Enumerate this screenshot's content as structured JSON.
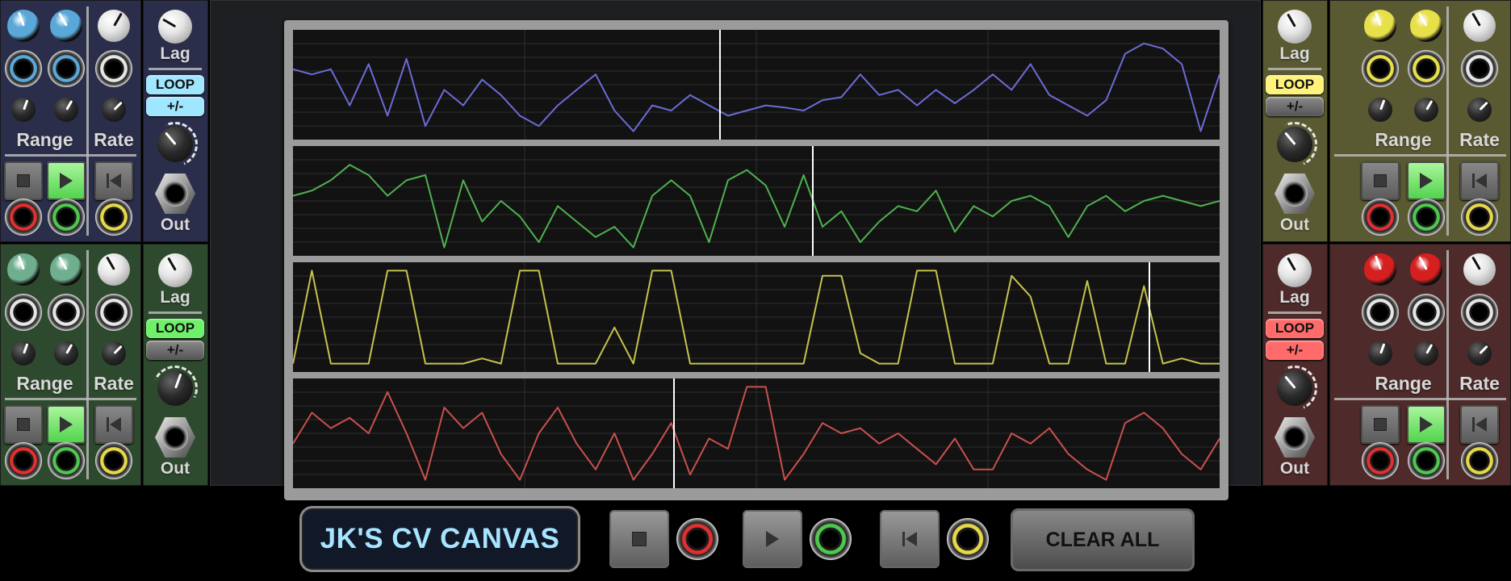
{
  "title": "JK'S CV CANVAS",
  "clear_label": "CLEAR ALL",
  "labels": {
    "lag": "Lag",
    "out": "Out",
    "range": "Range",
    "rate": "Rate",
    "loop": "LOOP",
    "plusminus": "+/-"
  },
  "modules": [
    {
      "id": "blue",
      "accent": "#5aa8d8",
      "bg": "#2b2e4a",
      "side_bg": "#2b2e4a",
      "loop_color": "#9fe6ff",
      "pm_color": "#9fe6ff",
      "loop_on": true,
      "pm_on": true
    },
    {
      "id": "green",
      "accent": "#6fae8e",
      "bg": "#2e4a2e",
      "side_bg": "#2e4a2e",
      "loop_color": "#6ef06a",
      "pm_color": "#8a8a8a",
      "loop_on": true,
      "pm_on": false
    },
    {
      "id": "yellow",
      "accent": "#e8e04a",
      "bg": "#5a5a32",
      "side_bg": "#5a5a32",
      "loop_color": "#fff27a",
      "pm_color": "#8a8a8a",
      "loop_on": true,
      "pm_on": false
    },
    {
      "id": "red",
      "accent": "#d62020",
      "bg": "#4e2a2a",
      "side_bg": "#4e2a2a",
      "loop_color": "#ff6a6a",
      "pm_color": "#ff6a6a",
      "loop_on": true,
      "pm_on": true
    }
  ],
  "colors": {
    "frame": "#9b9b9b",
    "track_bg": "#121212",
    "jack_red": "#e03030",
    "jack_green": "#4ec84e",
    "jack_yellow": "#e6d84a",
    "title_text": "#a6e4ff"
  },
  "tracks": [
    {
      "color": "#6b6bd6",
      "cursor": 0.46,
      "points": [
        0.35,
        0.4,
        0.35,
        0.7,
        0.3,
        0.8,
        0.25,
        0.9,
        0.55,
        0.7,
        0.45,
        0.6,
        0.8,
        0.9,
        0.7,
        0.55,
        0.4,
        0.75,
        0.95,
        0.7,
        0.75,
        0.6,
        0.7,
        0.8,
        0.75,
        0.7,
        0.72,
        0.75,
        0.65,
        0.62,
        0.4,
        0.6,
        0.55,
        0.7,
        0.55,
        0.68,
        0.55,
        0.4,
        0.55,
        0.3,
        0.6,
        0.7,
        0.8,
        0.65,
        0.2,
        0.1,
        0.15,
        0.3,
        0.95,
        0.4
      ]
    },
    {
      "color": "#4fb04f",
      "cursor": 0.56,
      "points": [
        0.45,
        0.4,
        0.3,
        0.15,
        0.25,
        0.45,
        0.3,
        0.25,
        0.95,
        0.3,
        0.7,
        0.5,
        0.65,
        0.9,
        0.55,
        0.7,
        0.85,
        0.75,
        0.95,
        0.45,
        0.3,
        0.45,
        0.9,
        0.3,
        0.2,
        0.35,
        0.75,
        0.25,
        0.75,
        0.6,
        0.9,
        0.7,
        0.55,
        0.6,
        0.4,
        0.8,
        0.55,
        0.65,
        0.5,
        0.45,
        0.55,
        0.85,
        0.55,
        0.45,
        0.6,
        0.5,
        0.45,
        0.5,
        0.55,
        0.5
      ]
    },
    {
      "color": "#c6c24e",
      "cursor": 0.923,
      "points": [
        0.95,
        0.05,
        0.95,
        0.95,
        0.95,
        0.05,
        0.05,
        0.95,
        0.95,
        0.95,
        0.9,
        0.95,
        0.05,
        0.05,
        0.95,
        0.95,
        0.95,
        0.6,
        0.95,
        0.05,
        0.05,
        0.95,
        0.95,
        0.95,
        0.95,
        0.95,
        0.95,
        0.95,
        0.1,
        0.1,
        0.85,
        0.95,
        0.95,
        0.05,
        0.05,
        0.95,
        0.95,
        0.95,
        0.1,
        0.3,
        0.95,
        0.95,
        0.15,
        0.95,
        0.95,
        0.2,
        0.95,
        0.9,
        0.95,
        0.95
      ]
    },
    {
      "color": "#c8504e",
      "cursor": 0.41,
      "points": [
        0.6,
        0.3,
        0.45,
        0.35,
        0.5,
        0.1,
        0.5,
        0.95,
        0.25,
        0.45,
        0.3,
        0.7,
        0.95,
        0.5,
        0.25,
        0.6,
        0.85,
        0.5,
        0.95,
        0.7,
        0.4,
        0.9,
        0.55,
        0.65,
        0.05,
        0.05,
        0.95,
        0.7,
        0.4,
        0.5,
        0.45,
        0.6,
        0.5,
        0.65,
        0.8,
        0.55,
        0.85,
        0.85,
        0.5,
        0.6,
        0.45,
        0.7,
        0.85,
        0.95,
        0.4,
        0.3,
        0.45,
        0.7,
        0.85,
        0.55
      ]
    }
  ]
}
